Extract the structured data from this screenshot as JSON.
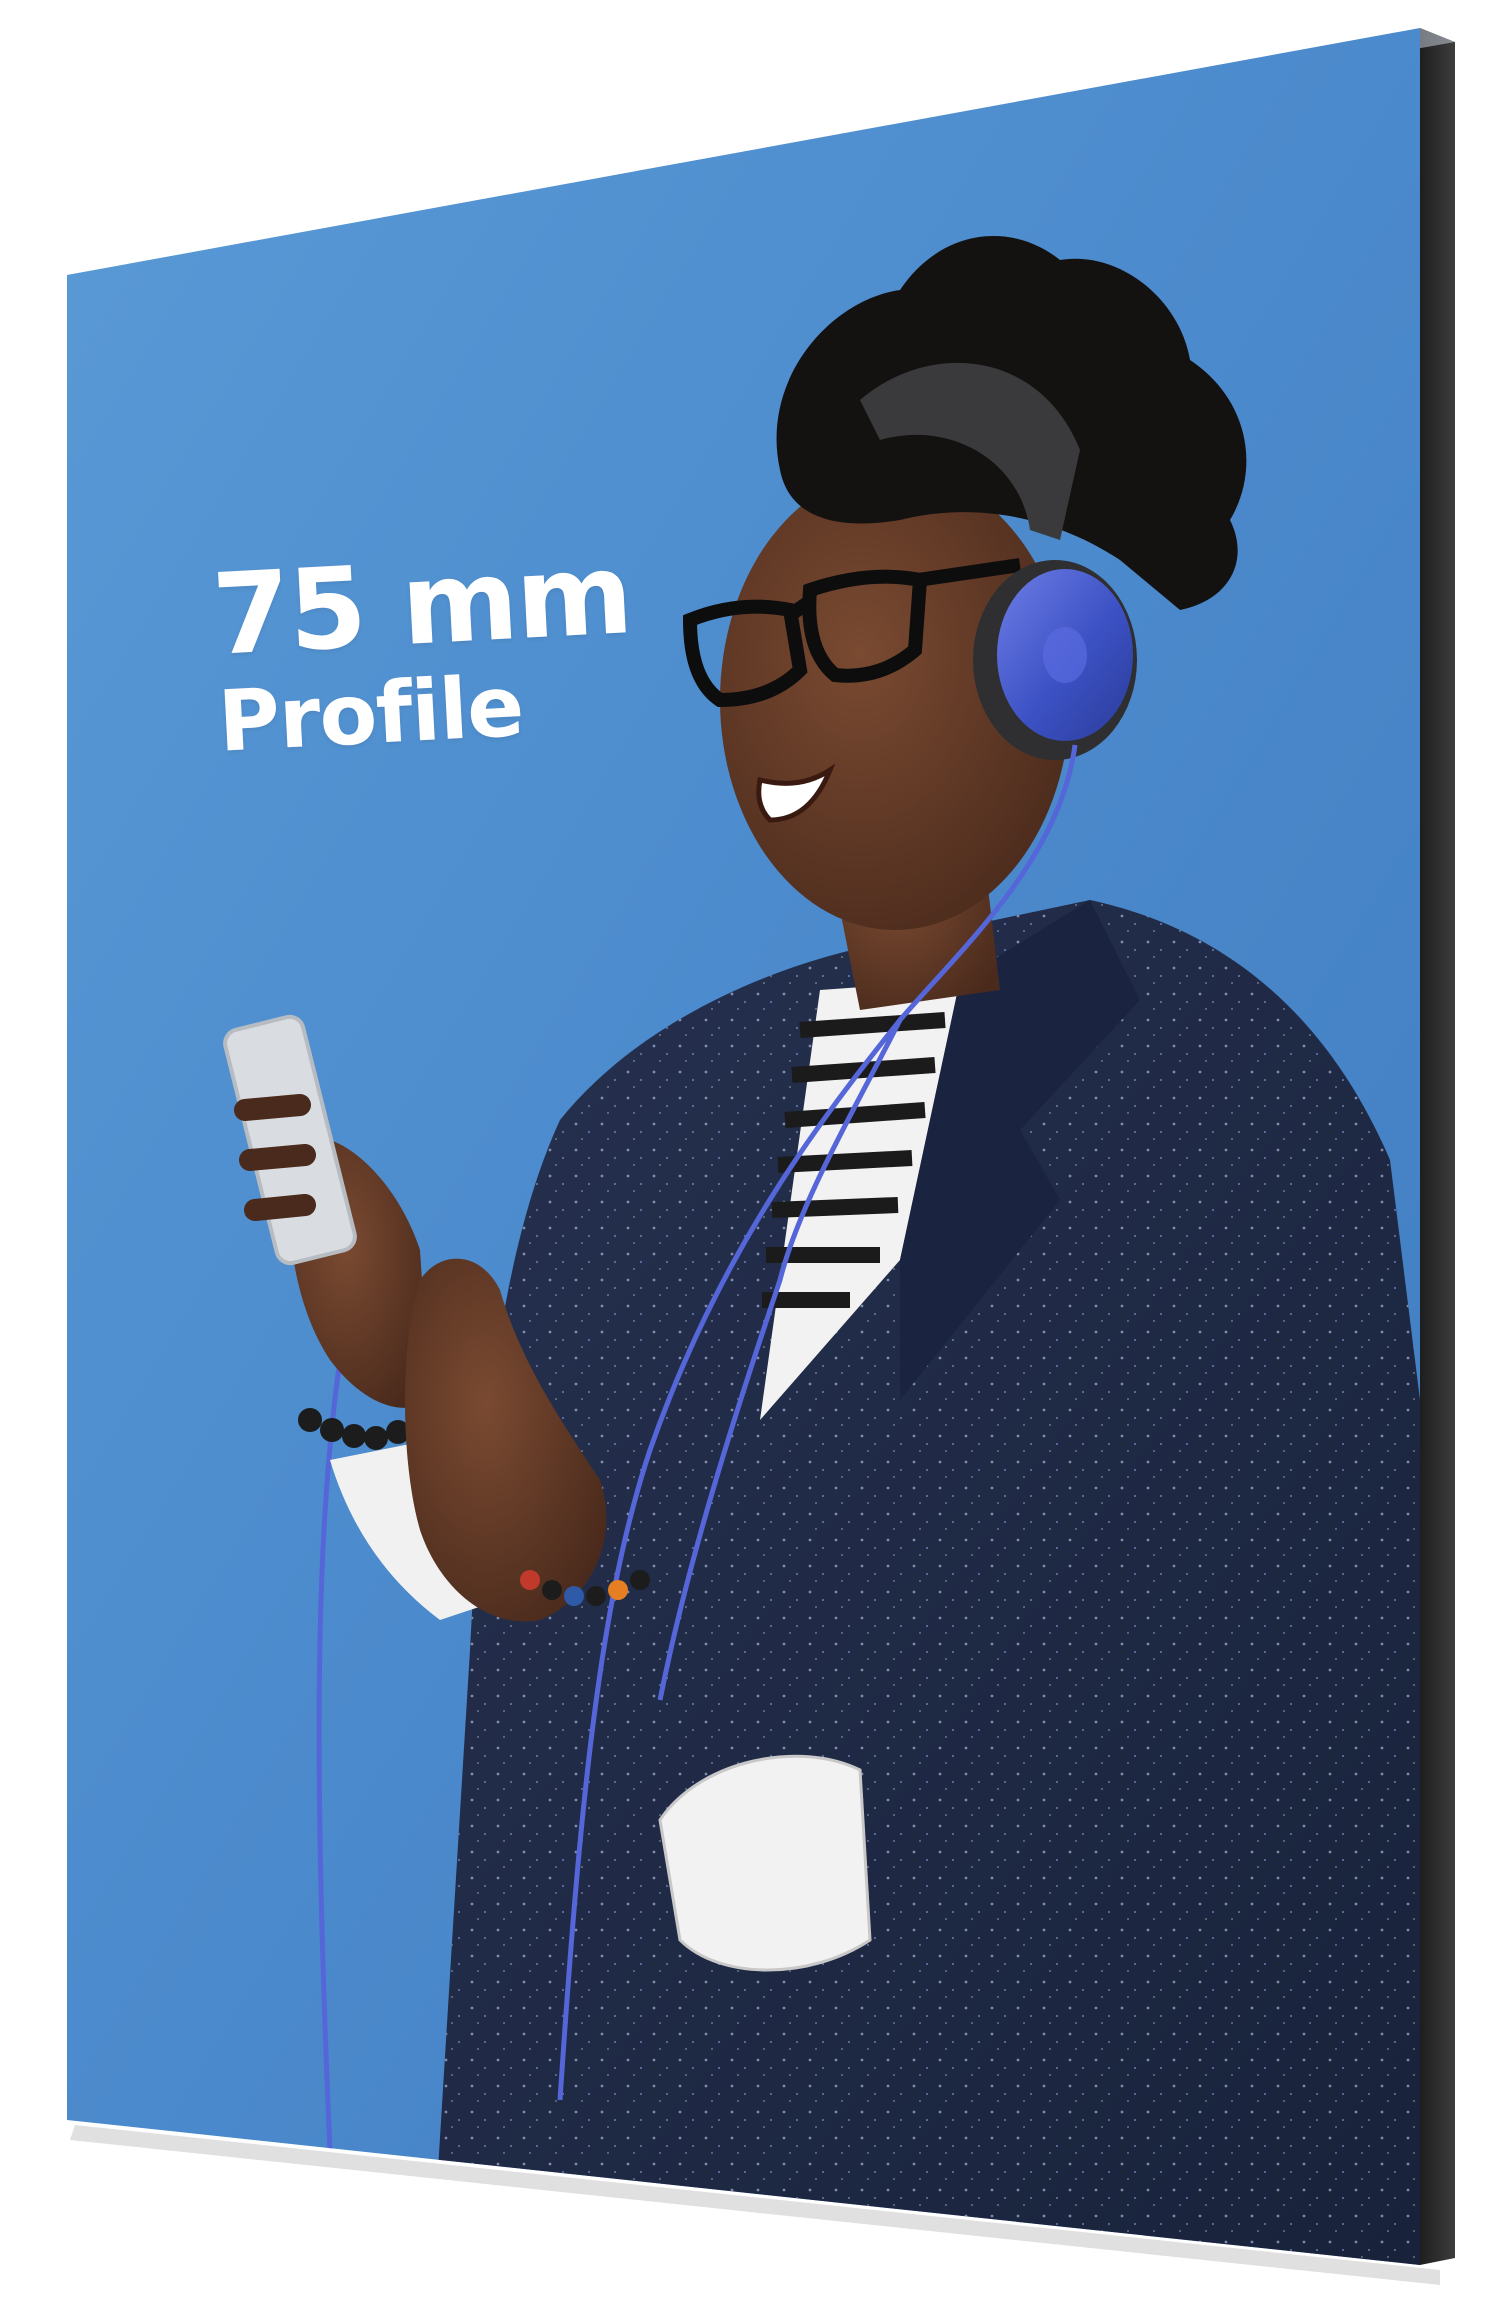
{
  "product": {
    "headline_line1": "75 mm",
    "headline_line2": "Profile"
  },
  "colors": {
    "background": "#ffffff",
    "panel_blue": "#4f8fd0",
    "frame_dark": "#2c2c2c",
    "jacket_navy": "#1f2a45",
    "headphone_blue": "#3f57c9"
  },
  "icons": {
    "person": "person-with-headphones-icon",
    "phone": "smartphone-icon"
  }
}
